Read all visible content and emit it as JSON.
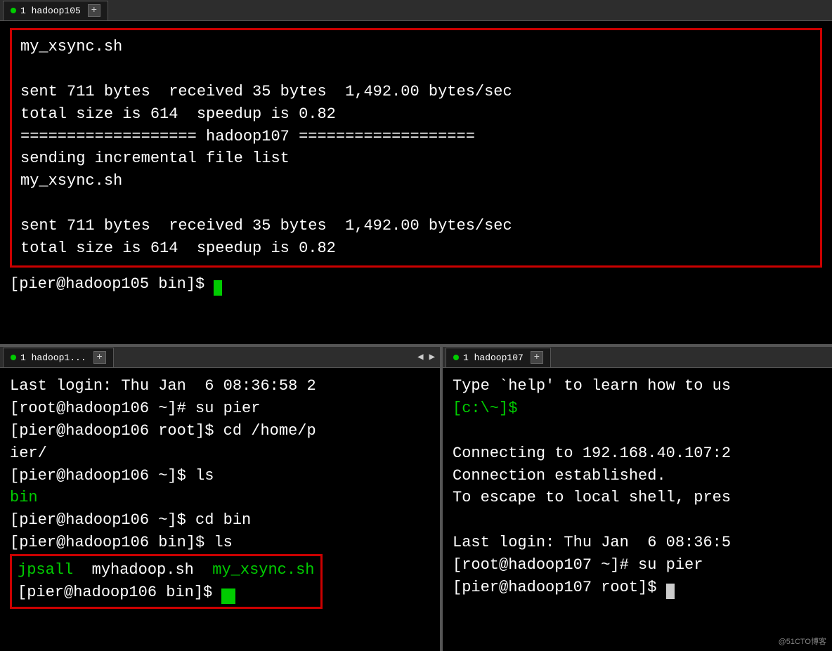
{
  "topTab": {
    "dot": true,
    "label": "1 hadoop105",
    "plus": "+"
  },
  "topPane": {
    "line1": "my_xsync.sh",
    "line2": "",
    "line3": "sent 711 bytes  received 35 bytes  1,492.00 bytes/sec",
    "line4": "total size is 614  speedup is 0.82",
    "line5": "=================== hadoop107 ===================",
    "line6": "sending incremental file list",
    "line7": "my_xsync.sh",
    "line8": "",
    "line9": "sent 711 bytes  received 35 bytes  1,492.00 bytes/sec",
    "line10": "total size is 614  speedup is 0.82",
    "prompt": "[pier@hadoop105 bin]$ "
  },
  "bottomLeftTab": {
    "dot": true,
    "label": "1 hadoop1...",
    "plus": "+"
  },
  "bottomLeftPane": {
    "line1": "Last login: Thu Jan  6 08:36:58 2",
    "line2": "[root@hadoop106 ~]# su pier",
    "line3": "[pier@hadoop106 root]$ cd /home/p",
    "line4": "ier/",
    "line5": "[pier@hadoop106 ~]$ ls",
    "line6": "bin",
    "line7": "[pier@hadoop106 ~]$ cd bin",
    "line8": "[pier@hadoop106 bin]$ ls",
    "redBox": {
      "line1_col1": "jpsall",
      "line1_col2": "myhadoop.sh",
      "line1_col3": "my_xsync.sh",
      "line2": "[pier@hadoop106 bin]$ "
    }
  },
  "bottomRightTab": {
    "dot": true,
    "label": "1 hadoop107",
    "plus": "+"
  },
  "bottomRightPane": {
    "line1": "Type `help' to learn how to us",
    "line2prompt": "[c:\\~]$ ",
    "line3": "",
    "line4": "Connecting to 192.168.40.107:2",
    "line5": "Connection established.",
    "line6": "To escape to local shell, pres",
    "line7": "",
    "line8": "Last login: Thu Jan  6 08:36:5",
    "line9": "[root@hadoop107 ~]# su pier",
    "line10": "[pier@hadoop107 root]$ "
  },
  "watermark": "@51CTO博客"
}
